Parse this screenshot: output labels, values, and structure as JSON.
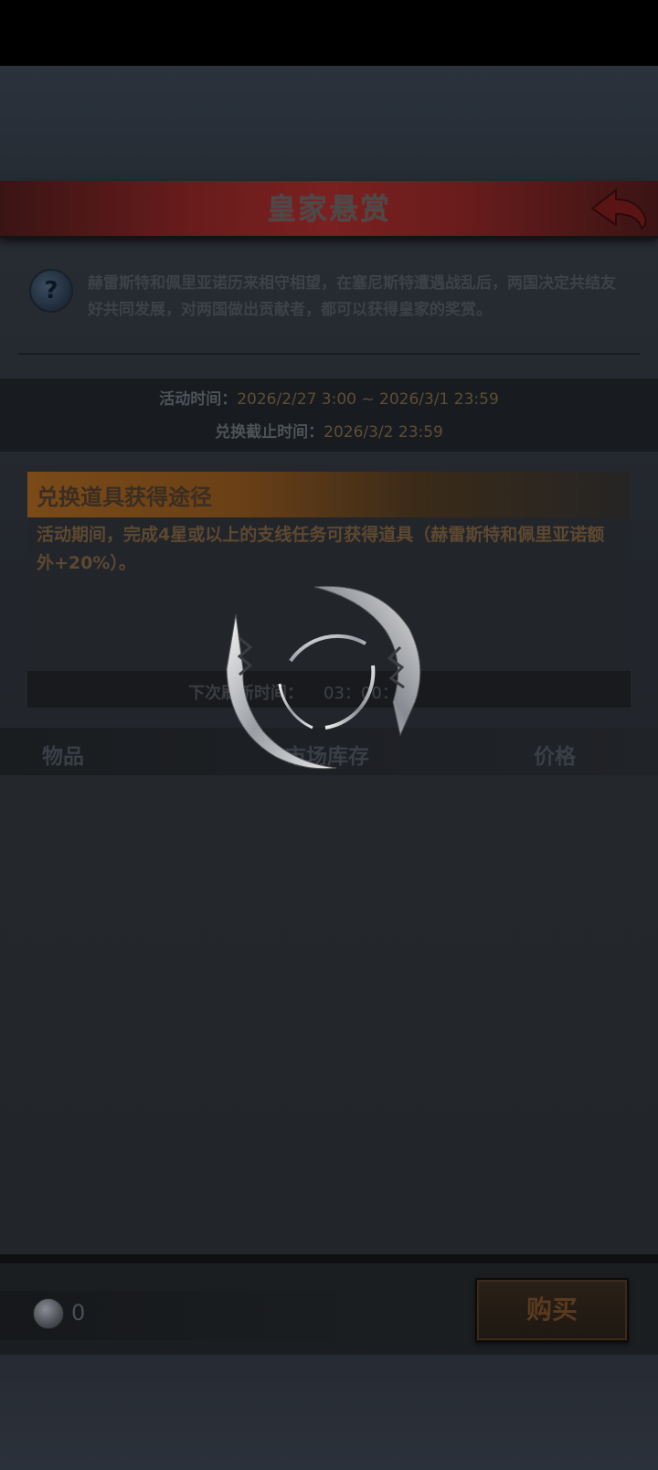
{
  "header": {
    "title": "皇家悬赏"
  },
  "intro": {
    "help_icon_glyph": "?",
    "text": "赫雷斯特和佩里亚诺历来相守相望，在塞尼斯特遭遇战乱后，两国决定共结友好共同发展，对两国做出贡献者，都可以获得皇家的奖赏。"
  },
  "event_time": {
    "activity_label": "活动时间：",
    "activity_value": "2026/2/27 3:00 ~ 2026/3/1 23:59",
    "exchange_label": "兑换截止时间：",
    "exchange_value": "2026/3/2 23:59"
  },
  "ways": {
    "title": "兑换道具获得途径",
    "desc": "活动期间，完成4星或以上的支线任务可获得道具（赫雷斯特和佩里亚诺额外+20%）。"
  },
  "refresh": {
    "label": "下次刷新时间：",
    "value": "03：00：00"
  },
  "table": {
    "columns": [
      "物品",
      "市场库存",
      "价格"
    ]
  },
  "footer": {
    "coin_icon": "silver-coin-icon",
    "coin_count": "0",
    "buy_label": "购买"
  },
  "overlay": {
    "state": "loading",
    "icon": "loading-spinner-icon"
  },
  "colors": {
    "banner": "#6a1c1c",
    "ways_header": "#7a4a18",
    "time_value": "#5e4e34",
    "buy_text": "#5a3a1e"
  }
}
